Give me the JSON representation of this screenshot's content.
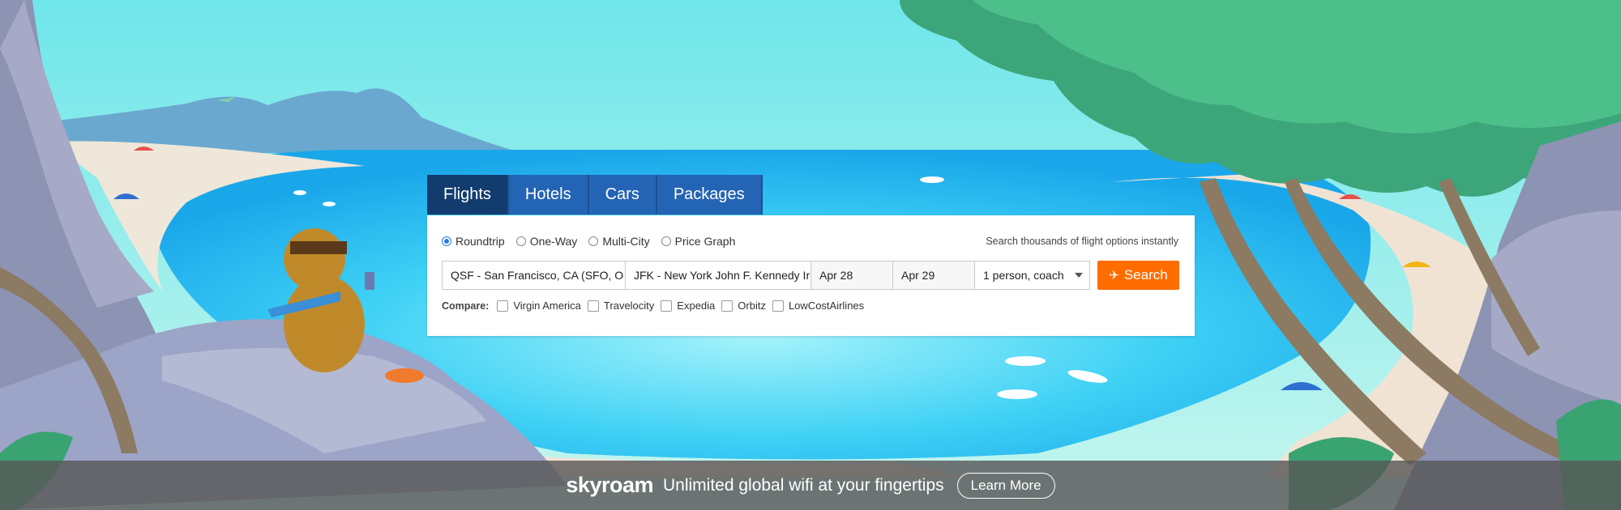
{
  "search": {
    "tabs": [
      {
        "label": "Flights",
        "active": true
      },
      {
        "label": "Hotels",
        "active": false
      },
      {
        "label": "Cars",
        "active": false
      },
      {
        "label": "Packages",
        "active": false
      }
    ],
    "trip_types": [
      {
        "label": "Roundtrip",
        "selected": true
      },
      {
        "label": "One-Way",
        "selected": false
      },
      {
        "label": "Multi-City",
        "selected": false
      },
      {
        "label": "Price Graph",
        "selected": false
      }
    ],
    "tagline": "Search thousands of flight options instantly",
    "from_value": "QSF - San Francisco, CA (SFO, O",
    "to_value": "JFK - New York John F. Kennedy Ir",
    "depart_date": "Apr 28",
    "return_date": "Apr 29",
    "passengers": "1 person, coach",
    "search_label": "Search",
    "compare_label": "Compare:",
    "compare_sites": [
      "Virgin America",
      "Travelocity",
      "Expedia",
      "Orbitz",
      "LowCostAirlines"
    ]
  },
  "ad": {
    "logo": "skyroam",
    "text": "Unlimited global wifi at your fingertips",
    "cta": "Learn More"
  },
  "colors": {
    "accent": "#ff6c00",
    "tab_active": "#123c6e",
    "tab": "#2464b4",
    "radio_selected": "#2a7ae2"
  },
  "icons": {
    "search_button": "airplane-icon",
    "passengers_dropdown": "caret-down-icon"
  }
}
